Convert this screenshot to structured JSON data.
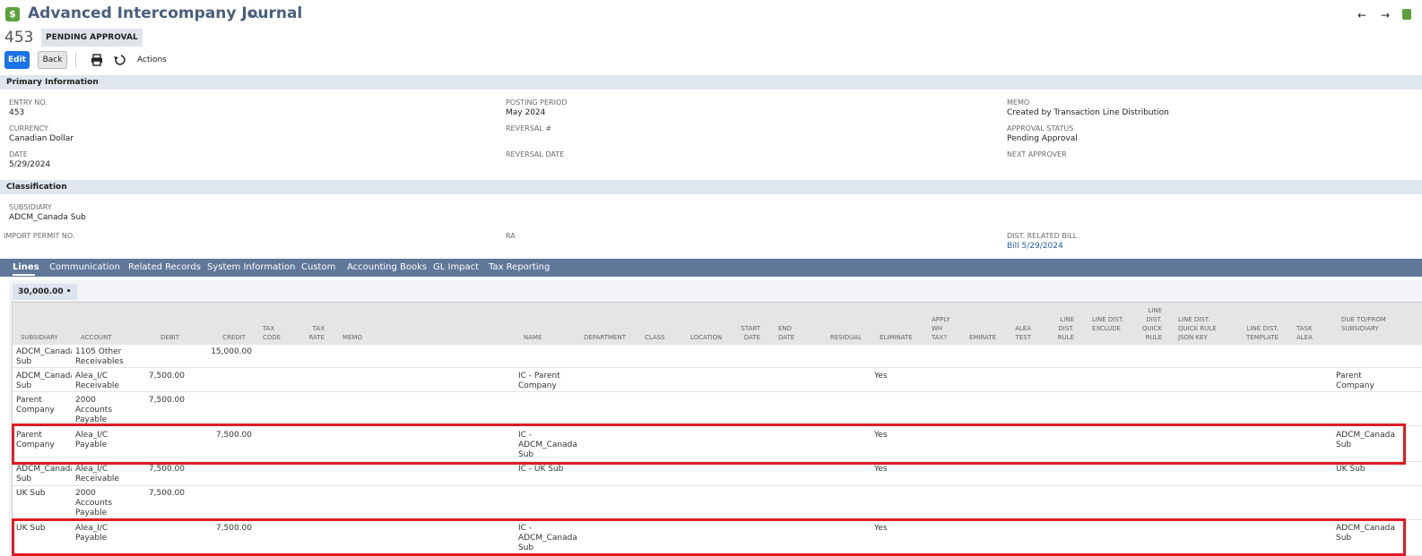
{
  "header": {
    "title": "Advanced Intercompany Journal",
    "entry_number": "453",
    "status": "PENDING APPROVAL",
    "logo_icon": "dollar-icon"
  },
  "toolbar": {
    "edit_label": "Edit",
    "back_label": "Back",
    "actions_label": "Actions"
  },
  "primary": {
    "section_title": "Primary Information",
    "entry_no_label": "ENTRY NO.",
    "entry_no": "453",
    "currency_label": "CURRENCY",
    "currency": "Canadian Dollar",
    "date_label": "DATE",
    "date": "5/29/2024",
    "posting_period_label": "POSTING PERIOD",
    "posting_period": "May 2024",
    "reversal_label": "REVERSAL #",
    "reversal_date_label": "REVERSAL DATE",
    "memo_label": "MEMO",
    "memo": "Created by Transaction Line Distribution",
    "approval_status_label": "APPROVAL STATUS",
    "approval_status": "Pending Approval",
    "next_approver_label": "NEXT APPROVER"
  },
  "classification": {
    "section_title": "Classification",
    "subsidiary_label": "SUBSIDIARY",
    "subsidiary": "ADCM_Canada Sub",
    "import_permit_label": "IMPORT PERMIT NO.",
    "ra_label": "RA",
    "dist_related_bill_label": "DIST. RELATED BILL",
    "dist_related_bill": "Bill 5/29/2024"
  },
  "tabs": [
    {
      "label": "Lines"
    },
    {
      "label": "Communication"
    },
    {
      "label": "Related Records"
    },
    {
      "label": "System Information"
    },
    {
      "label": "Custom"
    },
    {
      "label": "Accounting Books"
    },
    {
      "label": "GL Impact"
    },
    {
      "label": "Tax Reporting"
    }
  ],
  "lines": {
    "total": "30,000.00 •",
    "columns": {
      "subsidiary": "SUBSIDIARY",
      "account": "ACCOUNT",
      "debit": "DEBIT",
      "credit": "CREDIT",
      "tax_code": "TAX CODE",
      "tax_rate": "TAX RATE",
      "memo": "MEMO",
      "name": "NAME",
      "department": "DEPARTMENT",
      "class": "CLASS",
      "location": "LOCATION",
      "start_date": "START DATE",
      "end_date": "END DATE",
      "residual": "RESIDUAL",
      "eliminate": "ELIMINATE",
      "apply_wh_tax": "APPLY WH TAX?",
      "emirate": "EMIRATE",
      "alea_test": "ALEA TEST",
      "line_dist_rule": "LINE DIST. RULE",
      "line_dist_exclude": "LINE DIST. EXCLUDE",
      "line_dist_quick_rule": "LINE DIST. QUICK RULE",
      "line_dist_quick_rule_json": "LINE DIST. QUICK RULE JSON KEY",
      "line_dist_template": "LINE DIST. TEMPLATE",
      "task_alea": "TASK ALEA",
      "due_to_from": "DUE TO/FROM SUBSIDIARY"
    },
    "rows": [
      {
        "subsidiary": "ADCM_Canada Sub",
        "account": "1105 Other Receivables",
        "debit": "",
        "credit": "15,000.00",
        "name": "",
        "eliminate": "",
        "due": ""
      },
      {
        "subsidiary": "ADCM_Canada Sub",
        "account": "Alea_I/C Receivable",
        "debit": "7,500.00",
        "credit": "",
        "name": "IC - Parent Company",
        "eliminate": "Yes",
        "due": "Parent Company"
      },
      {
        "subsidiary": "Parent Company",
        "account": "2000 Accounts Payable",
        "debit": "7,500.00",
        "credit": "",
        "name": "",
        "eliminate": "",
        "due": ""
      },
      {
        "subsidiary": "Parent Company",
        "account": "Alea_I/C Payable",
        "debit": "",
        "credit": "7,500.00",
        "name": "IC - ADCM_Canada Sub",
        "eliminate": "Yes",
        "due": "ADCM_Canada Sub"
      },
      {
        "subsidiary": "ADCM_Canada Sub",
        "account": "Alea_I/C Receivable",
        "debit": "7,500.00",
        "credit": "",
        "name": "IC - UK Sub",
        "eliminate": "Yes",
        "due": "UK Sub"
      },
      {
        "subsidiary": "UK Sub",
        "account": "2000 Accounts Payable",
        "debit": "7,500.00",
        "credit": "",
        "name": "",
        "eliminate": "",
        "due": ""
      },
      {
        "subsidiary": "UK Sub",
        "account": "Alea_I/C Payable",
        "debit": "",
        "credit": "7,500.00",
        "name": "IC - ADCM_Canada Sub",
        "eliminate": "Yes",
        "due": "ADCM_Canada Sub"
      }
    ]
  },
  "colors": {
    "title": "#4a5f7c",
    "tab_bar": "#607799",
    "section_bar": "#e0e6ee",
    "link": "#255ba5",
    "edit_button": "#1a73e8",
    "highlight": "#e01b24"
  }
}
